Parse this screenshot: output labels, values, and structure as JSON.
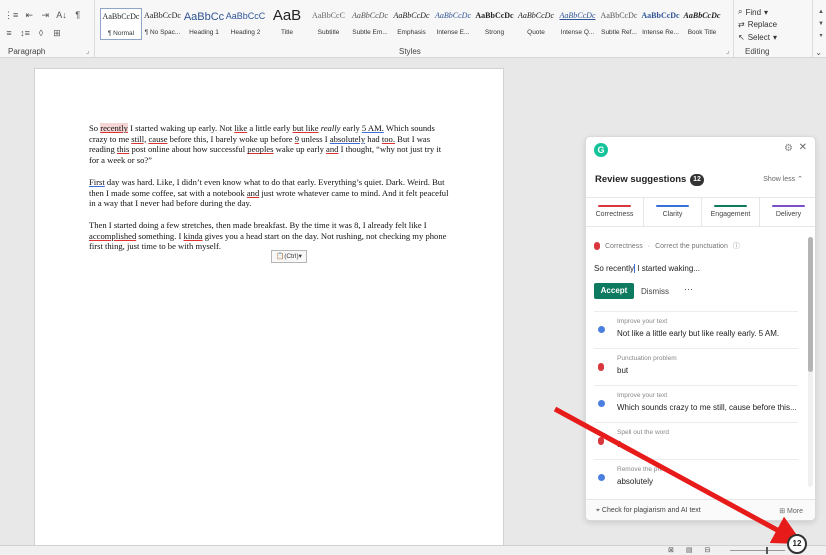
{
  "ribbon": {
    "paragraph": {
      "row1": [
        "⋮≡",
        "⇤",
        "⇥",
        "A↓",
        "¶"
      ],
      "row2": [
        "≡",
        "↕≡",
        "◊",
        "⊞"
      ],
      "label": "Paragraph"
    },
    "styles": {
      "label": "Styles",
      "items": [
        {
          "sample": "AaBbCcDc",
          "name": "¶ Normal"
        },
        {
          "sample": "AaBbCcDc",
          "name": "¶ No Spac..."
        },
        {
          "sample": "AaBbCc",
          "name": "Heading 1"
        },
        {
          "sample": "AaBbCcC",
          "name": "Heading 2"
        },
        {
          "sample": "AaB",
          "name": "Title"
        },
        {
          "sample": "AaBbCcC",
          "name": "Subtitle"
        },
        {
          "sample": "AaBbCcDc",
          "name": "Subtle Em..."
        },
        {
          "sample": "AaBbCcDc",
          "name": "Emphasis"
        },
        {
          "sample": "AaBbCcDc",
          "name": "Intense E..."
        },
        {
          "sample": "AaBbCcDc",
          "name": "Strong"
        },
        {
          "sample": "AaBbCcDc",
          "name": "Quote"
        },
        {
          "sample": "AaBbCcDc",
          "name": "Intense Q..."
        },
        {
          "sample": "AaBbCcDc",
          "name": "Subtle Ref..."
        },
        {
          "sample": "AaBbCcDc",
          "name": "Intense Re..."
        },
        {
          "sample": "AaBbCcDc",
          "name": "Book Title"
        }
      ]
    },
    "editing": {
      "label": "Editing",
      "find": "Find",
      "replace": "Replace",
      "select": "Select"
    }
  },
  "document": {
    "paragraphs": [
      [
        {
          "t": "So "
        },
        {
          "t": "recently",
          "s": "red-hl"
        },
        {
          "t": " I started waking up early. Not "
        },
        {
          "t": "like",
          "s": "red"
        },
        {
          "t": " a little early "
        },
        {
          "t": "but like",
          "s": "red"
        },
        {
          "t": " "
        },
        {
          "t": "really",
          "s": "italic"
        },
        {
          "t": " early "
        },
        {
          "t": "5 AM.",
          "s": "blue"
        },
        {
          "t": " Which sounds crazy to me "
        },
        {
          "t": "still,",
          "s": "red"
        },
        {
          "t": " "
        },
        {
          "t": "cause",
          "s": "red"
        },
        {
          "t": " before this, I barely woke up before "
        },
        {
          "t": "9",
          "s": "red"
        },
        {
          "t": " unless I "
        },
        {
          "t": "absolutely",
          "s": "blue"
        },
        {
          "t": " had "
        },
        {
          "t": "too.",
          "s": "red"
        },
        {
          "t": " But I was reading "
        },
        {
          "t": "this",
          "s": "red"
        },
        {
          "t": " post online about how successful "
        },
        {
          "t": "peoples",
          "s": "red"
        },
        {
          "t": " wake up early "
        },
        {
          "t": "and",
          "s": "red"
        },
        {
          "t": " I thought, “why not just try it for a week or so?”"
        }
      ],
      [
        {
          "t": "First",
          "s": "blue"
        },
        {
          "t": " day was hard. Like, I didn’t even know what to do that early. Everything’s quiet. Dark. Weird. But then I made some coffee, sat with a notebook "
        },
        {
          "t": "and",
          "s": "red"
        },
        {
          "t": " just wrote whatever came to mind. And it felt peaceful in a way that I never had before during the day."
        }
      ],
      [
        {
          "t": "Then I started doing a few stretches, then made breakfast. By the time it was 8, I already felt like I "
        },
        {
          "t": "accomplished",
          "s": "red"
        },
        {
          "t": " something. I "
        },
        {
          "t": "kinda",
          "s": "red"
        },
        {
          "t": " gives you a head start on the day. Not rushing, not checking my phone first thing, just time to be with myself."
        }
      ]
    ],
    "paste_options": "(Ctrl)"
  },
  "grammarly": {
    "logo": "G",
    "title": "Review suggestions",
    "count": "12",
    "show_less": "Show less",
    "categories": [
      {
        "label": "Correctness",
        "color": "#d9363e"
      },
      {
        "label": "Clarity",
        "color": "#3a6fd8"
      },
      {
        "label": "Engagement",
        "color": "#0e7a5f"
      },
      {
        "label": "Delivery",
        "color": "#7a4fc9"
      }
    ],
    "active_card": {
      "category": "Correctness",
      "separator": "·",
      "message": "Correct the punctuation",
      "preview_before": "So recently",
      "preview_after": " I started waking...",
      "accept": "Accept",
      "dismiss": "Dismiss",
      "more": "···"
    },
    "suggestions": [
      {
        "kind": "Improve your text",
        "text": "Not like a little early but like really early. 5 AM.",
        "icon": "blue"
      },
      {
        "kind": "Punctuation problem",
        "text": "but",
        "icon": "red"
      },
      {
        "kind": "Improve your text",
        "text": "Which sounds crazy to me still, cause before this...",
        "icon": "blue"
      },
      {
        "kind": "Spell out the word",
        "text": "9",
        "icon": "red"
      },
      {
        "kind": "Remove the phr...",
        "text": "absolutely",
        "icon": "blue"
      }
    ],
    "footer": {
      "plagiarism": "Check for plagiarism and AI text",
      "more": "More"
    }
  },
  "status_bar": {
    "badge_count": "12"
  }
}
